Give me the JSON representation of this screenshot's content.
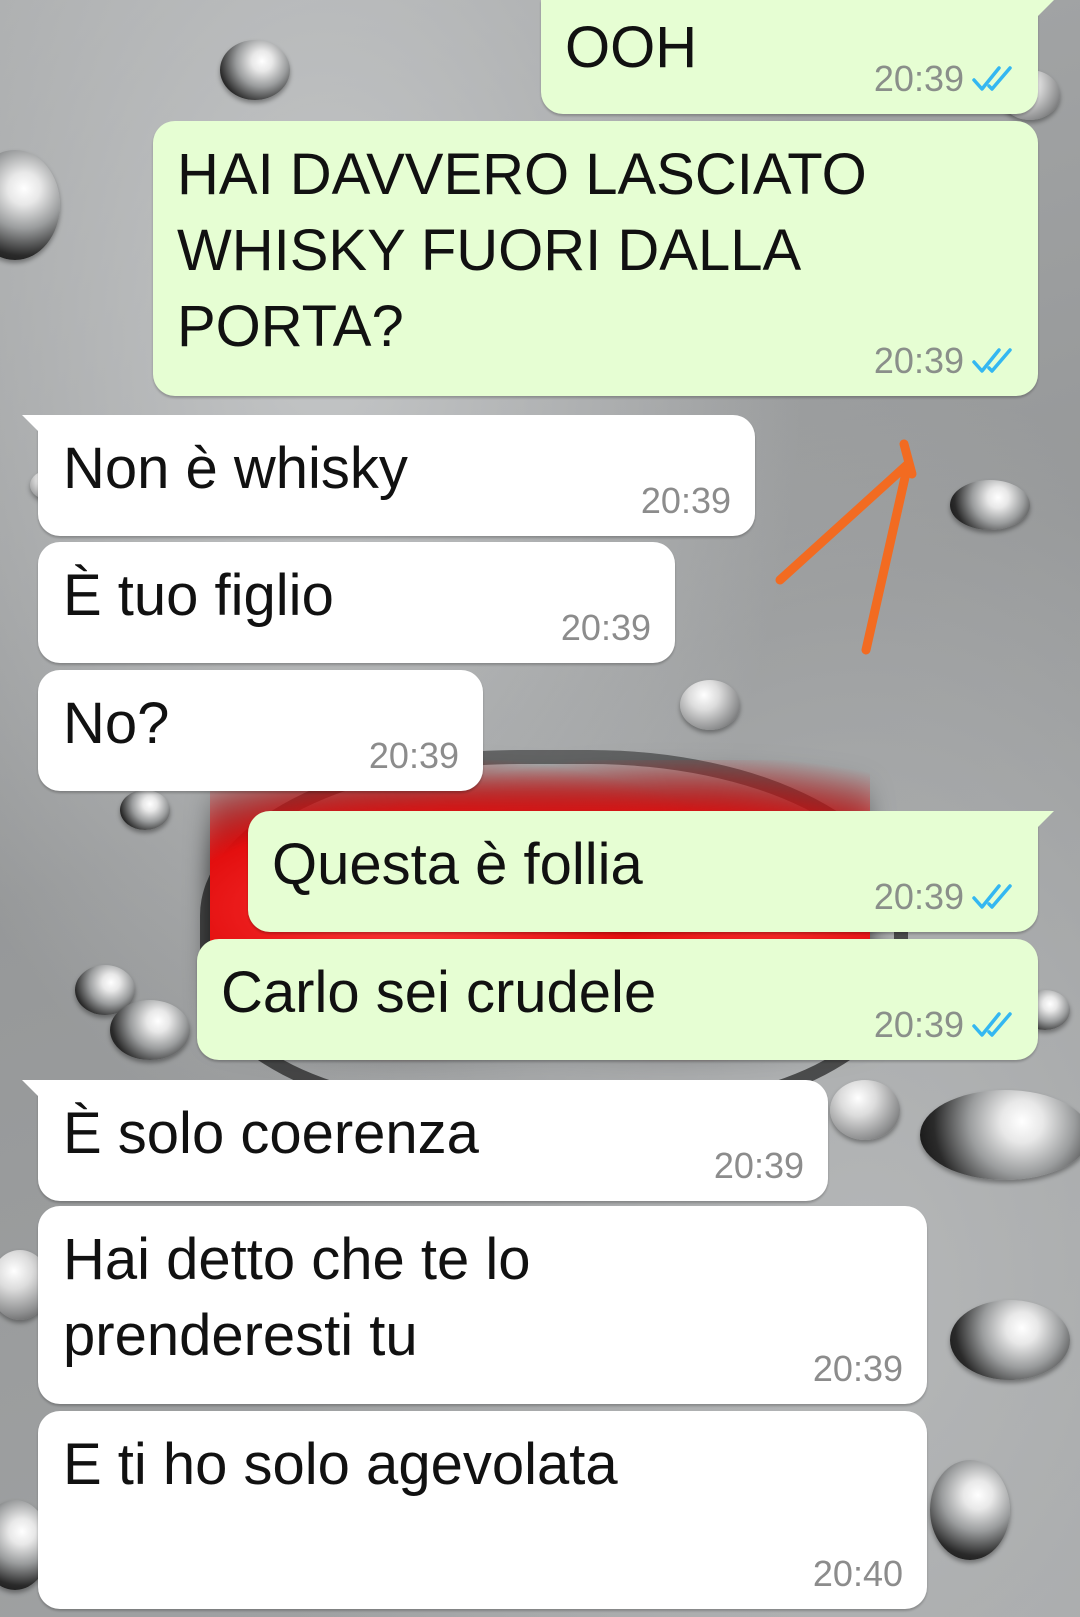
{
  "messages": [
    {
      "direction": "outgoing",
      "text": "OOH",
      "time": "20:39",
      "status": "read-icon"
    },
    {
      "direction": "outgoing",
      "text": "HAI DAVVERO LASCIATO WHISKY FUORI DALLA PORTA?",
      "time": "20:39",
      "status": "read-icon"
    },
    {
      "direction": "incoming",
      "text": "Non è whisky",
      "time": "20:39"
    },
    {
      "direction": "incoming",
      "text": "È tuo figlio",
      "time": "20:39"
    },
    {
      "direction": "incoming",
      "text": "No?",
      "time": "20:39"
    },
    {
      "direction": "outgoing",
      "text": "Questa è follia",
      "time": "20:39",
      "status": "read-icon"
    },
    {
      "direction": "outgoing",
      "text": "Carlo sei crudele",
      "time": "20:39",
      "status": "read-icon"
    },
    {
      "direction": "incoming",
      "text": "È solo coerenza",
      "time": "20:39"
    },
    {
      "direction": "incoming",
      "text": "Hai detto che te lo prenderesti tu",
      "time": "20:39"
    },
    {
      "direction": "incoming",
      "text": "E ti ho solo agevolata",
      "time": "20:40"
    }
  ],
  "colors": {
    "outgoing_bubble": "#e6fed3",
    "incoming_bubble": "#ffffff",
    "read_ticks": "#34b7f1",
    "annotation_arrow": "#f26b21",
    "wallpaper_heart": "#e30f0f"
  },
  "icons": [
    "read-receipt-double-check-icon",
    "hand-drawn-arrow-annotation"
  ]
}
